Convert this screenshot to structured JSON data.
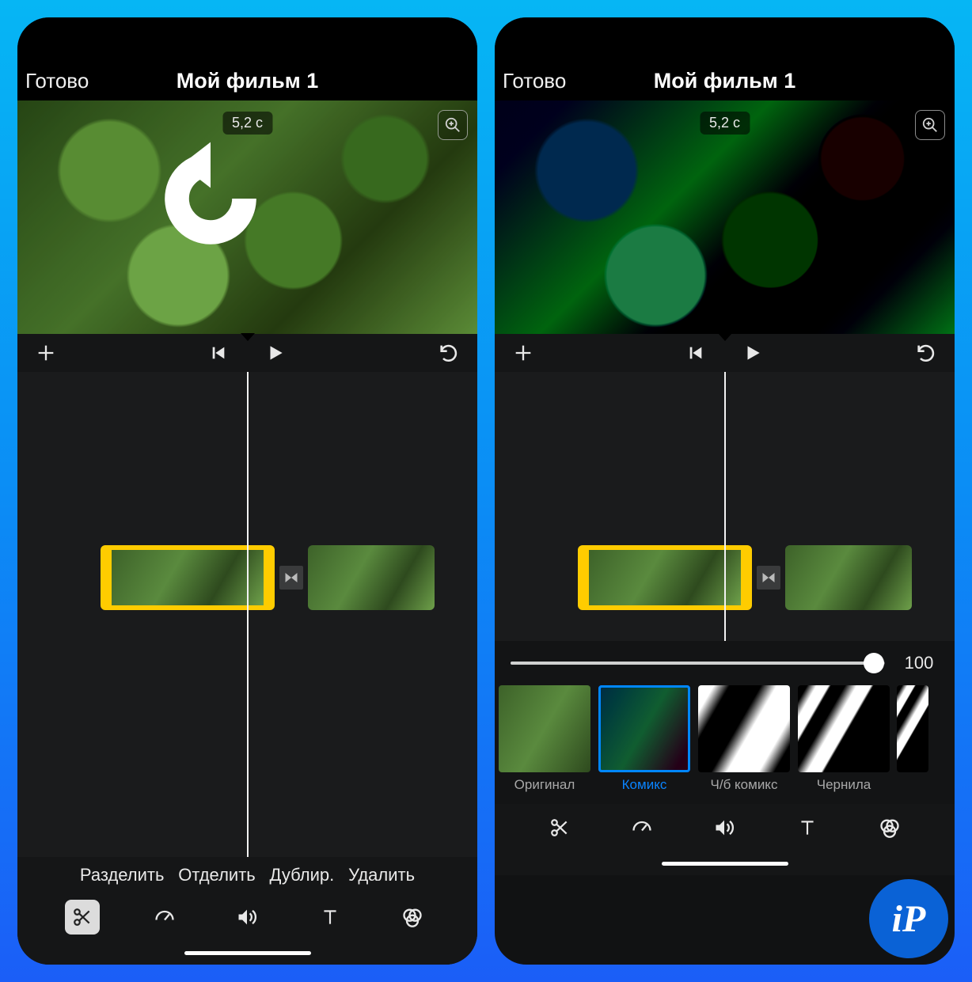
{
  "left": {
    "done": "Готово",
    "title": "Мой фильм 1",
    "clip_time": "5,2 c",
    "actions": {
      "split": "Разделить",
      "detach": "Отделить",
      "duplicate": "Дублир.",
      "delete": "Удалить"
    }
  },
  "right": {
    "done": "Готово",
    "title": "Мой фильм 1",
    "clip_time": "5,2 c",
    "slider_value": "100",
    "filters": {
      "original": "Оригинал",
      "comic": "Комикс",
      "bw_comic": "Ч/б комикс",
      "ink": "Чернила"
    }
  },
  "badge": "iP"
}
